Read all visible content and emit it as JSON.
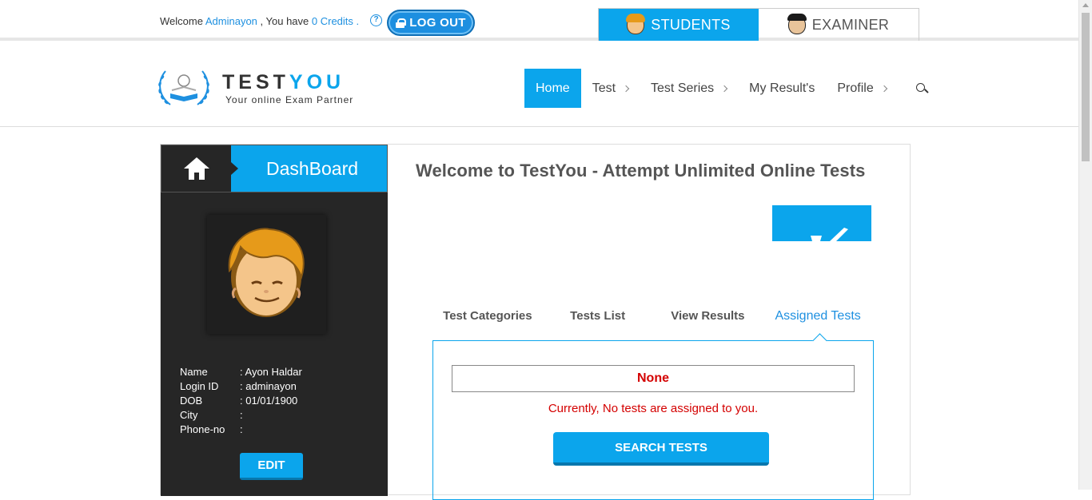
{
  "topbar": {
    "welcome_prefix": "Welcome",
    "username": "Adminayon",
    "have_text": ", You have",
    "credits": "0 Credits",
    "period": ".",
    "logout_label": "LOG OUT",
    "roles": [
      {
        "label": "STUDENTS",
        "active": true,
        "icon": "student-face-icon"
      },
      {
        "label": "EXAMINER",
        "active": false,
        "icon": "examiner-face-icon"
      }
    ]
  },
  "brand": {
    "name_part1": "TEST",
    "name_part2": "YOU",
    "tagline": "Your online Exam Partner",
    "accent": "#0ba5ec"
  },
  "nav": {
    "items": [
      {
        "label": "Home"
      },
      {
        "label": "Test"
      },
      {
        "label": "Test Series"
      },
      {
        "label": "My Result's"
      },
      {
        "label": "Profile"
      }
    ]
  },
  "sidebar": {
    "dashboard_title": "DashBoard",
    "profile": [
      {
        "label": "Name",
        "value": ": Ayon Haldar"
      },
      {
        "label": "Login ID",
        "value": ": adminayon"
      },
      {
        "label": "DOB",
        "value": ": 01/01/1900"
      },
      {
        "label": "City",
        "value": ":"
      },
      {
        "label": "Phone-no",
        "value": ":"
      }
    ],
    "edit_label": "EDIT"
  },
  "main": {
    "title": "Welcome to TestYou - Attempt Unlimited Online Tests",
    "tabs": [
      {
        "label": "Test Categories"
      },
      {
        "label": "Tests List"
      },
      {
        "label": "View Results"
      },
      {
        "label": "Assigned Tests"
      }
    ],
    "select_value": "None",
    "empty_message": "Currently, No tests are assigned to you.",
    "search_button": "SEARCH TESTS"
  }
}
